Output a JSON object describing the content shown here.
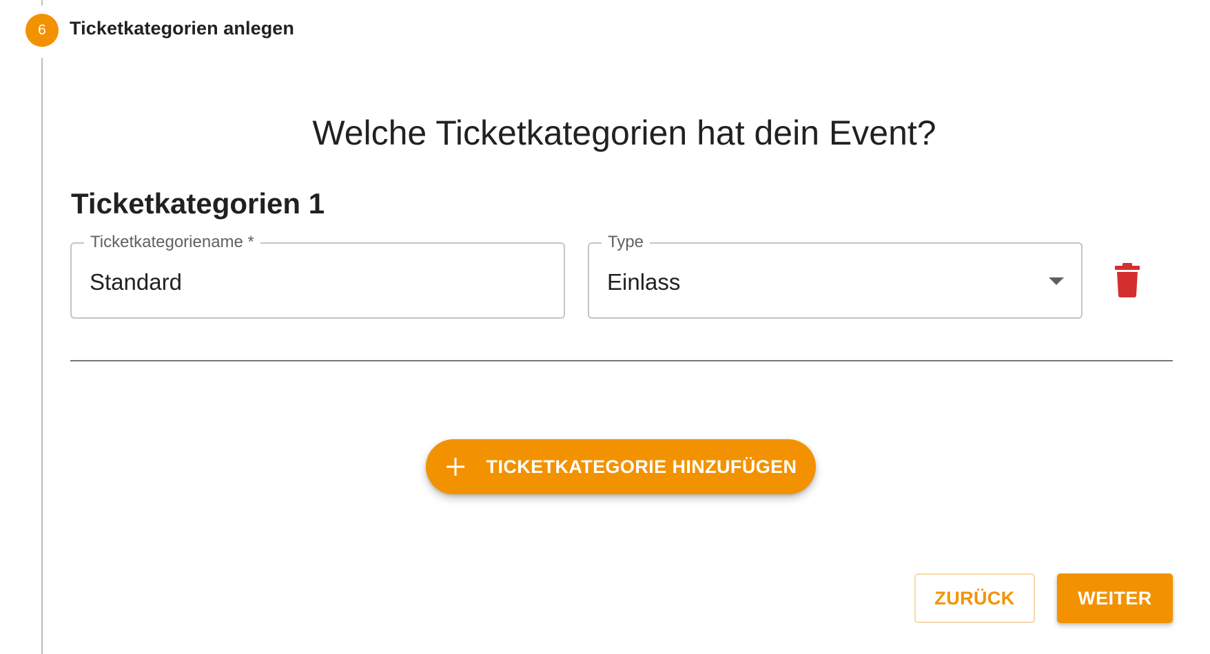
{
  "stepper": {
    "step_number": "6",
    "step_title": "Ticketkategorien anlegen"
  },
  "main": {
    "question": "Welche Ticketkategorien hat dein Event?",
    "categories": [
      {
        "heading": "Ticketkategorien 1",
        "name_field": {
          "label": "Ticketkategoriename *",
          "value": "Standard"
        },
        "type_field": {
          "label": "Type",
          "value": "Einlass"
        },
        "delete_icon": "trash-icon"
      }
    ],
    "add_button": {
      "icon": "plus-icon",
      "label": "TICKETKATEGORIE HINZUFÜGEN"
    }
  },
  "footer": {
    "back_label": "ZURÜCK",
    "next_label": "WEITER"
  },
  "colors": {
    "accent": "#f39200",
    "delete": "#d32f2f",
    "text": "#212121",
    "border": "#c4c4c4"
  }
}
